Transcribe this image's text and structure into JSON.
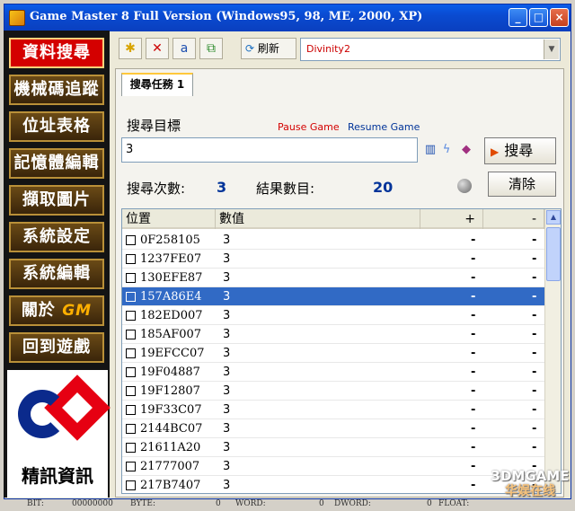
{
  "window": {
    "title": "Game Master 8 Full Version (Windows95, 98, ME, 2000, XP)",
    "min": "_",
    "max": "□",
    "close": "×"
  },
  "menu": {
    "items": [
      {
        "label": "資料搜尋"
      },
      {
        "label": "機械碼追蹤"
      },
      {
        "label": "位址表格"
      },
      {
        "label": "記憶體編輯"
      },
      {
        "label": "擷取圖片"
      },
      {
        "label": "系統設定"
      },
      {
        "label": "系統編輯"
      },
      {
        "label": "關於"
      },
      {
        "label": "回到遊戲"
      }
    ],
    "about_logo": "GM",
    "company": "精訊資訊"
  },
  "toolbar": {
    "refresh_label": "刷新",
    "process_name": "Divinity2",
    "icons": [
      "sparkle-icon",
      "delete-icon",
      "text-icon",
      "copy-icon",
      "refresh-icon"
    ]
  },
  "search": {
    "tab_label": "搜尋任務 1",
    "target_label": "搜尋目標",
    "pause": "Pause Game",
    "resume": "Resume Game",
    "value": "3",
    "button_label": "搜尋",
    "count_label": "搜尋次數:",
    "count_value": "3",
    "result_label": "結果數目:",
    "result_value": "20",
    "clear_label": "清除"
  },
  "table": {
    "headers": [
      "位置",
      "數值",
      "+",
      "-"
    ],
    "rows": [
      {
        "addr": "0F258105",
        "val": "3",
        "plus": "-",
        "minus": "-"
      },
      {
        "addr": "1237FE07",
        "val": "3",
        "plus": "-",
        "minus": "-"
      },
      {
        "addr": "130EFE87",
        "val": "3",
        "plus": "-",
        "minus": "-"
      },
      {
        "addr": "157A86E4",
        "val": "3",
        "plus": "-",
        "minus": "-"
      },
      {
        "addr": "182ED007",
        "val": "3",
        "plus": "-",
        "minus": "-"
      },
      {
        "addr": "185AF007",
        "val": "3",
        "plus": "-",
        "minus": "-"
      },
      {
        "addr": "19EFCC07",
        "val": "3",
        "plus": "-",
        "minus": "-"
      },
      {
        "addr": "19F04887",
        "val": "3",
        "plus": "-",
        "minus": "-"
      },
      {
        "addr": "19F12807",
        "val": "3",
        "plus": "-",
        "minus": "-"
      },
      {
        "addr": "19F33C07",
        "val": "3",
        "plus": "-",
        "minus": "-"
      },
      {
        "addr": "2144BC07",
        "val": "3",
        "plus": "-",
        "minus": "-"
      },
      {
        "addr": "21611A20",
        "val": "3",
        "plus": "-",
        "minus": "-"
      },
      {
        "addr": "21777007",
        "val": "3",
        "plus": "-",
        "minus": "-"
      },
      {
        "addr": "217B7407",
        "val": "3",
        "plus": "-",
        "minus": "-"
      }
    ]
  },
  "status": {
    "bit": "BIT:",
    "bit_val": "00000000",
    "byte": "BYTE:",
    "byte_val": "0",
    "word": "WORD:",
    "word_val": "0",
    "dword": "DWORD:",
    "dword_val": "0",
    "float": "FLOAT:"
  },
  "watermark": {
    "line1": "3DMGAME",
    "line2": "华娱在线"
  },
  "colors": {
    "selected_row": "#316ac5",
    "title_blue": "#0a4bd1",
    "menu_active": "#d40000"
  }
}
